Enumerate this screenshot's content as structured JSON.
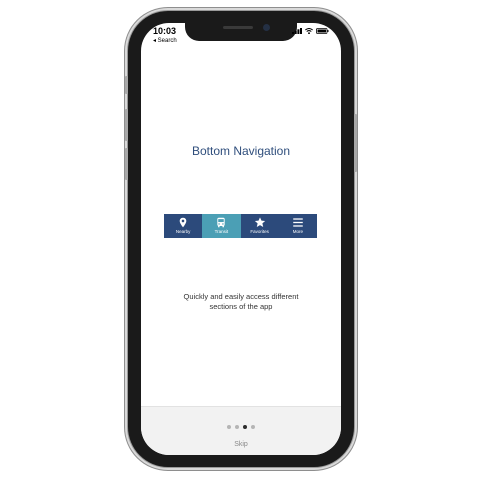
{
  "status_bar": {
    "time": "10:03",
    "back_label": "◂ Search"
  },
  "onboarding": {
    "title": "Bottom Navigation",
    "description_line1": "Quickly and easily access different",
    "description_line2": "sections of the app"
  },
  "navbar": {
    "items": [
      {
        "label": "Nearby",
        "icon": "map-pin-icon",
        "active": false
      },
      {
        "label": "Transit",
        "icon": "bus-icon",
        "active": true
      },
      {
        "label": "Favorites",
        "icon": "star-icon",
        "active": false
      },
      {
        "label": "More",
        "icon": "menu-icon",
        "active": false
      }
    ],
    "colors": {
      "background": "#2c4a7b",
      "active": "#4b9fb5"
    }
  },
  "pager": {
    "total": 4,
    "current": 3,
    "skip_label": "Skip"
  },
  "colors": {
    "title": "#2f4e7c"
  }
}
